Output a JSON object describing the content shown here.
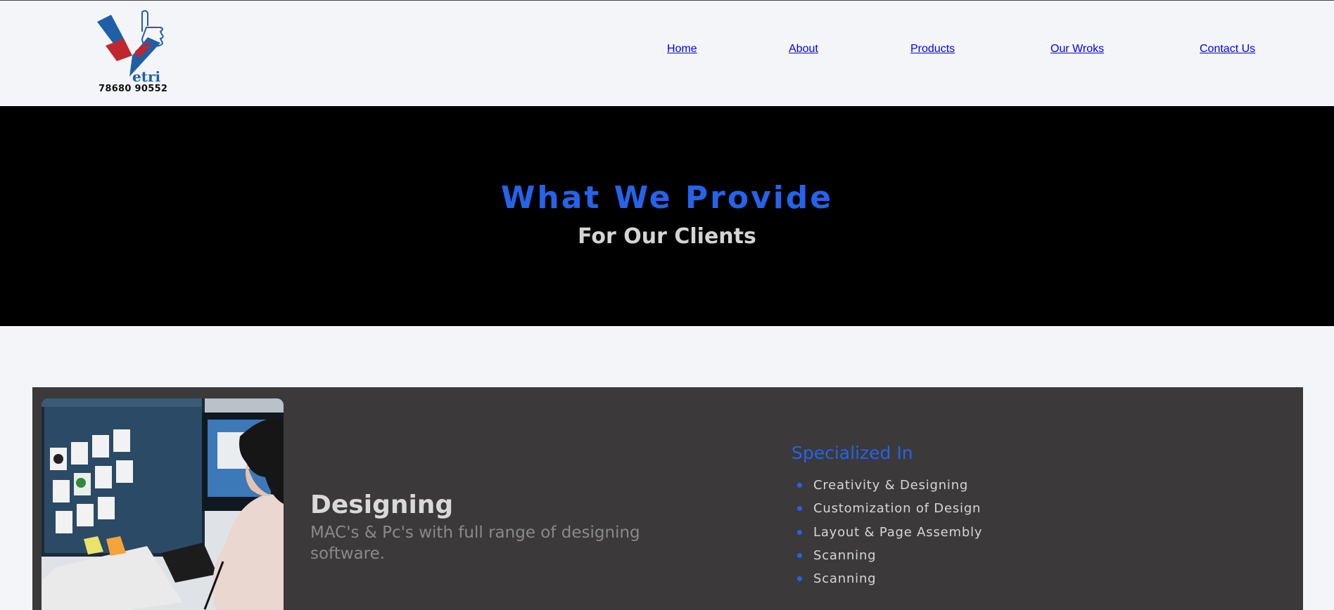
{
  "header": {
    "logo": {
      "brand_text": "etri",
      "phone": "78680 90552",
      "colors": {
        "blue": "#1f5fa8",
        "red": "#c0262d"
      }
    },
    "nav": [
      {
        "label": "Home"
      },
      {
        "label": "About"
      },
      {
        "label": "Products"
      },
      {
        "label": "Our Wroks"
      },
      {
        "label": "Contact Us"
      }
    ]
  },
  "hero": {
    "title": "What We Provide",
    "subtitle": "For Our Clients"
  },
  "service": {
    "title": "Designing",
    "description": "MAC's & Pc's with full range of designing software.",
    "specialized_title": "Specialized In",
    "specialized_items": [
      "Creativity & Designing",
      "Customization of Design",
      "Layout & Page Assembly",
      "Scanning",
      "Scanning"
    ]
  },
  "colors": {
    "accent": "#2563eb",
    "hero_bg": "#000000",
    "card_bg": "#3b393a",
    "page_bg": "#f4f5f9"
  }
}
